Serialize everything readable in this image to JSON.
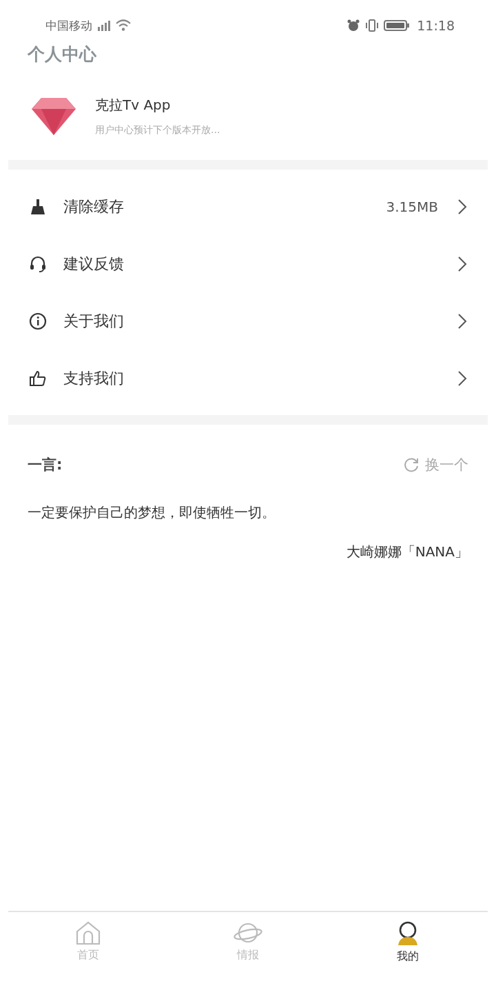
{
  "status_bar": {
    "carrier": "中国移动",
    "time": "11:18"
  },
  "header": {
    "title": "个人中心"
  },
  "profile": {
    "name": "克拉Tv App",
    "subtitle": "用户中心预计下个版本开放..."
  },
  "menu": [
    {
      "kind": "broom",
      "label": "清除缓存",
      "value": "3.15MB"
    },
    {
      "kind": "headset",
      "label": "建议反馈"
    },
    {
      "kind": "info",
      "label": "关于我们"
    },
    {
      "kind": "thumb",
      "label": "支持我们"
    }
  ],
  "quote": {
    "label": "一言:",
    "refresh": "换一个",
    "text": "一定要保护自己的梦想，即使牺牲一切。",
    "author": "大崎娜娜「NANA」"
  },
  "tabs": [
    {
      "kind": "home",
      "label": "首页",
      "selected": false
    },
    {
      "kind": "planet",
      "label": "情报",
      "selected": false
    },
    {
      "kind": "user",
      "label": "我的",
      "selected": true
    }
  ]
}
